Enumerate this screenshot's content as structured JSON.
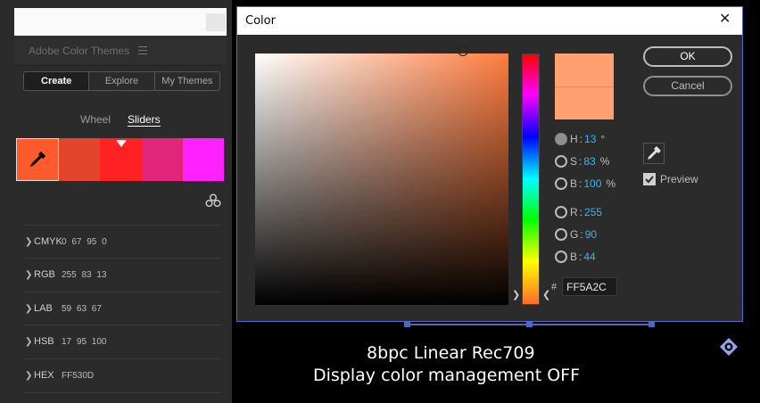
{
  "panel": {
    "title": "Adobe Color Themes",
    "tabs": [
      {
        "label": "Create",
        "active": true
      },
      {
        "label": "Explore",
        "active": false
      },
      {
        "label": "My Themes",
        "active": false
      }
    ],
    "modes": {
      "wheel": "Wheel",
      "sliders": "Sliders",
      "active": "Sliders"
    },
    "swatches": [
      "#ff5a2c",
      "#e2452b",
      "#ff2224",
      "#e0257a",
      "#ff21ff"
    ],
    "selected_swatch": 0,
    "color_modes": [
      {
        "label": "CMYK",
        "values": "0  67  95  0"
      },
      {
        "label": "RGB",
        "values": "255  83  13"
      },
      {
        "label": "LAB",
        "values": "59  63  67"
      },
      {
        "label": "HSB",
        "values": "17  95  100"
      },
      {
        "label": "HEX",
        "values": "FF530D"
      }
    ]
  },
  "dialog": {
    "title": "Color",
    "ok_label": "OK",
    "cancel_label": "Cancel",
    "preview_label": "Preview",
    "preview_checked": true,
    "current_color": "#ffa070",
    "channels": [
      {
        "key": "H",
        "value": "13",
        "unit": "°",
        "selected": true
      },
      {
        "key": "S",
        "value": "83",
        "unit": "%",
        "selected": false
      },
      {
        "key": "B",
        "value": "100",
        "unit": "%",
        "selected": false
      },
      {
        "key": "R",
        "value": "255",
        "unit": "",
        "selected": false
      },
      {
        "key": "G",
        "value": "90",
        "unit": "",
        "selected": false
      },
      {
        "key": "B",
        "value": "44",
        "unit": "",
        "selected": false
      }
    ],
    "hex_hash": "#",
    "hex_value": "FF5A2C"
  },
  "viewer": {
    "line1": "8bpc Linear Rec709",
    "line2": "Display color management OFF"
  }
}
